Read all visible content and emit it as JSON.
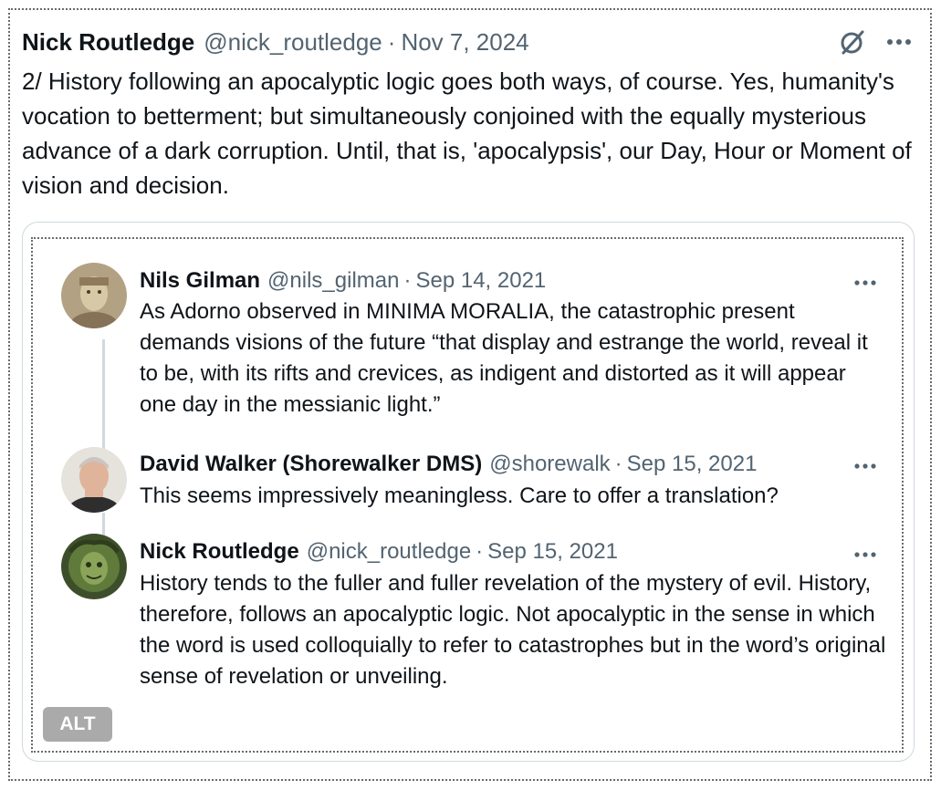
{
  "post": {
    "author": "Nick Routledge",
    "handle": "@nick_routledge",
    "separator": "·",
    "date": "Nov 7, 2024",
    "text": "2/ History following an apocalyptic logic goes both ways, of course. Yes, humanity's vocation to betterment; but simultaneously conjoined with the equally mysterious advance of a dark corruption. Until, that is, 'apocalypsis', our Day, Hour or Moment of vision and decision."
  },
  "toolbar": {
    "grok_icon": "grok-icon",
    "more_icon": "more-options-icon"
  },
  "media": {
    "alt_label": "ALT",
    "thread": [
      {
        "name": "Nils Gilman",
        "handle": "@nils_gilman",
        "separator": "·",
        "date": "Sep 14, 2021",
        "text": "As Adorno observed in MINIMA MORALIA, the catastrophic present demands visions of the future “that display and estrange the world, reveal it to be, with its rifts and crevices, as indigent and distorted as it will appear one day in the messianic light.”"
      },
      {
        "name": "David Walker (Shorewalker DMS)",
        "handle": "@shorewalk",
        "separator": "·",
        "date": "Sep 15, 2021",
        "text": "This seems impressively meaningless. Care to offer a translation?"
      },
      {
        "name": "Nick Routledge",
        "handle": "@nick_routledge",
        "separator": "·",
        "date": "Sep 15, 2021",
        "text": "History tends to the fuller and fuller revelation of the mystery of evil. History, therefore, follows an apocalyptic logic. Not apocalyptic in the sense in which the word is used colloquially to refer to catastrophes but in the word’s original sense of revelation or unveiling."
      }
    ]
  },
  "colors": {
    "text": "#0f1419",
    "muted": "#536471",
    "border": "#cfd9de"
  }
}
